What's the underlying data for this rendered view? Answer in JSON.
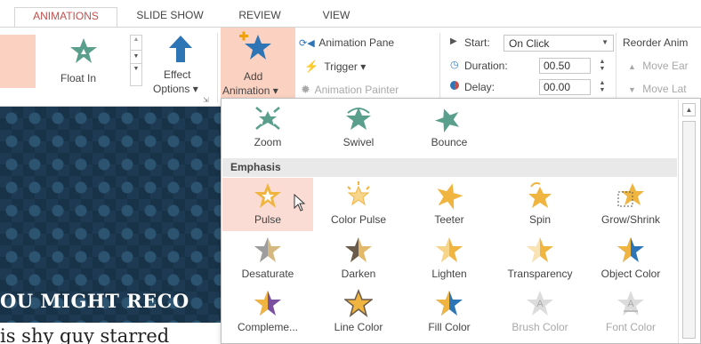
{
  "tabs": [
    "ANIMATIONS",
    "SLIDE SHOW",
    "REVIEW",
    "VIEW"
  ],
  "ribbon": {
    "current_effect": "Float In",
    "effect_options": [
      "Effect",
      "Options ▾"
    ],
    "add_animation": [
      "Add",
      "Animation ▾"
    ],
    "animation_pane": "Animation Pane",
    "trigger": "Trigger ▾",
    "animation_painter": "Animation Painter",
    "start_label": "Start:",
    "start_value": "On Click",
    "duration_label": "Duration:",
    "duration_value": "00.50",
    "delay_label": "Delay:",
    "delay_value": "00.00",
    "reorder_label": "Reorder Anim",
    "move_earlier": "Move Ear",
    "move_later": "Move Lat"
  },
  "slide": {
    "heading": "OU MIGHT RECO",
    "body": "is shy guy starred"
  },
  "gallery": {
    "section_emphasis": "Emphasis",
    "entrance_row": [
      "Zoom",
      "Swivel",
      "Bounce"
    ],
    "emphasis_rows": [
      [
        "Pulse",
        "Color Pulse",
        "Teeter",
        "Spin",
        "Grow/Shrink"
      ],
      [
        "Desaturate",
        "Darken",
        "Lighten",
        "Transparency",
        "Object Color"
      ],
      [
        "Compleme...",
        "Line Color",
        "Fill Color",
        "Brush Color",
        "Font Color"
      ]
    ]
  },
  "colors": {
    "accent": "#c0504d",
    "green_star": "#5a9f8b",
    "gold_star": "#f0b541",
    "blue_arrow": "#2e75b6",
    "highlight": "#fadcd4"
  }
}
